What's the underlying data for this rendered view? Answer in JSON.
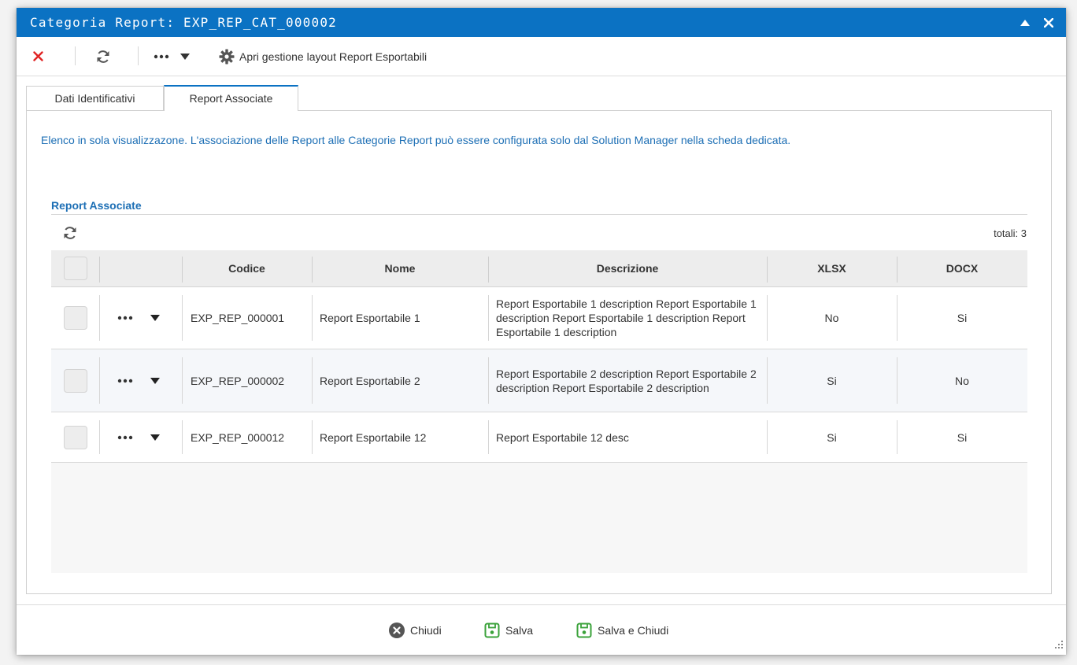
{
  "window": {
    "title": "Categoria Report: EXP_REP_CAT_000002",
    "controls": [
      "collapse-icon",
      "close-icon"
    ]
  },
  "toolbar": {
    "close_icon": "close-icon",
    "refresh_icon": "refresh-icon",
    "more_icon": "more-icon",
    "layout_label": "Apri gestione layout Report Esportabili",
    "layout_icon": "gear-icon"
  },
  "tabs": [
    {
      "label": "Dati Identificativi",
      "active": false
    },
    {
      "label": "Report Associate",
      "active": true
    }
  ],
  "info_text": "Elenco in sola visualizzazone. L'associazione delle Report alle Categorie Report può essere configurata solo dal Solution Manager nella scheda dedicata.",
  "section": {
    "title": "Report Associate",
    "totals": "totali: 3"
  },
  "table": {
    "headers": {
      "codice": "Codice",
      "nome": "Nome",
      "descrizione": "Descrizione",
      "xlsx": "XLSX",
      "docx": "DOCX"
    },
    "rows": [
      {
        "codice": "EXP_REP_000001",
        "nome": "Report Esportabile 1",
        "descrizione": "Report Esportabile 1 description Report Esportabile 1 description Report Esportabile 1 description Report Esportabile 1 description",
        "xlsx": "No",
        "docx": "Si"
      },
      {
        "codice": "EXP_REP_000002",
        "nome": "Report Esportabile 2",
        "descrizione": "Report Esportabile 2 description Report Esportabile 2 description Report Esportabile 2 description",
        "xlsx": "Si",
        "docx": "No"
      },
      {
        "codice": "EXP_REP_000012",
        "nome": "Report Esportabile 12",
        "descrizione": "Report Esportabile 12 desc",
        "xlsx": "Si",
        "docx": "Si"
      }
    ]
  },
  "footer": {
    "chiudi": "Chiudi",
    "salva": "Salva",
    "salva_chiudi": "Salva e Chiudi"
  },
  "colors": {
    "accent": "#0b72c3",
    "link_text": "#1d6fb5",
    "close_red": "#e02424",
    "save_green": "#3aa23a"
  }
}
